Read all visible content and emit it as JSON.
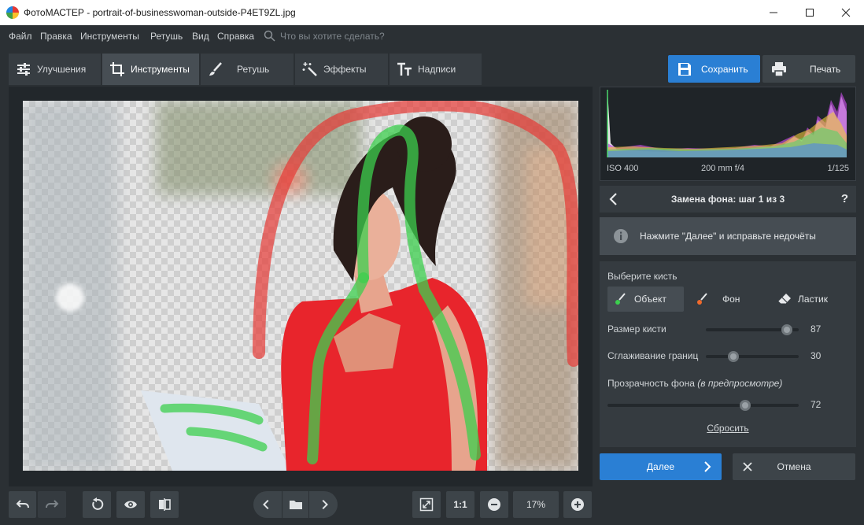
{
  "window": {
    "title": "ФотоМАСТЕР - portrait-of-businesswoman-outside-P4ET9ZL.jpg"
  },
  "menu": {
    "items": [
      "Файл",
      "Правка",
      "Инструменты",
      "Ретушь",
      "Вид",
      "Справка"
    ],
    "search_placeholder": "Что вы хотите сделать?"
  },
  "tabs": [
    {
      "label": "Улучшения",
      "icon": "sliders-icon"
    },
    {
      "label": "Инструменты",
      "icon": "crop-icon",
      "active": true
    },
    {
      "label": "Ретушь",
      "icon": "brush-icon"
    },
    {
      "label": "Эффекты",
      "icon": "magic-wand-icon"
    },
    {
      "label": "Надписи",
      "icon": "text-icon"
    }
  ],
  "actions": {
    "save_label": "Сохранить",
    "print_label": "Печать"
  },
  "histogram": {
    "iso": "ISO 400",
    "lens": "200 mm f/4",
    "shutter": "1/125"
  },
  "step": {
    "title": "Замена фона: шаг 1 из 3",
    "help": "?"
  },
  "hint": {
    "text": "Нажмите \"Далее\" и исправьте недочёты"
  },
  "brush": {
    "heading": "Выберите кисть",
    "options": [
      {
        "label": "Объект",
        "color": "#3ccf4e",
        "active": true
      },
      {
        "label": "Фон",
        "color": "#f06a2c"
      },
      {
        "label": "Ластик",
        "color": "#e8eaec"
      }
    ],
    "size_label": "Размер кисти",
    "size_value": 87,
    "smooth_label": "Сглаживание границ",
    "smooth_value": 30,
    "opacity_label": "Прозрачность фона",
    "opacity_hint": "(в предпросмотре)",
    "opacity_value": 72,
    "reset_label": "Сбросить"
  },
  "footer": {
    "next_label": "Далее",
    "cancel_label": "Отмена"
  },
  "toolbar": {
    "one_to_one": "1:1",
    "zoom": "17%"
  },
  "colors": {
    "accent": "#2a7fd4",
    "object_stroke": "#3ccf4e",
    "background_stroke": "#e53935"
  }
}
